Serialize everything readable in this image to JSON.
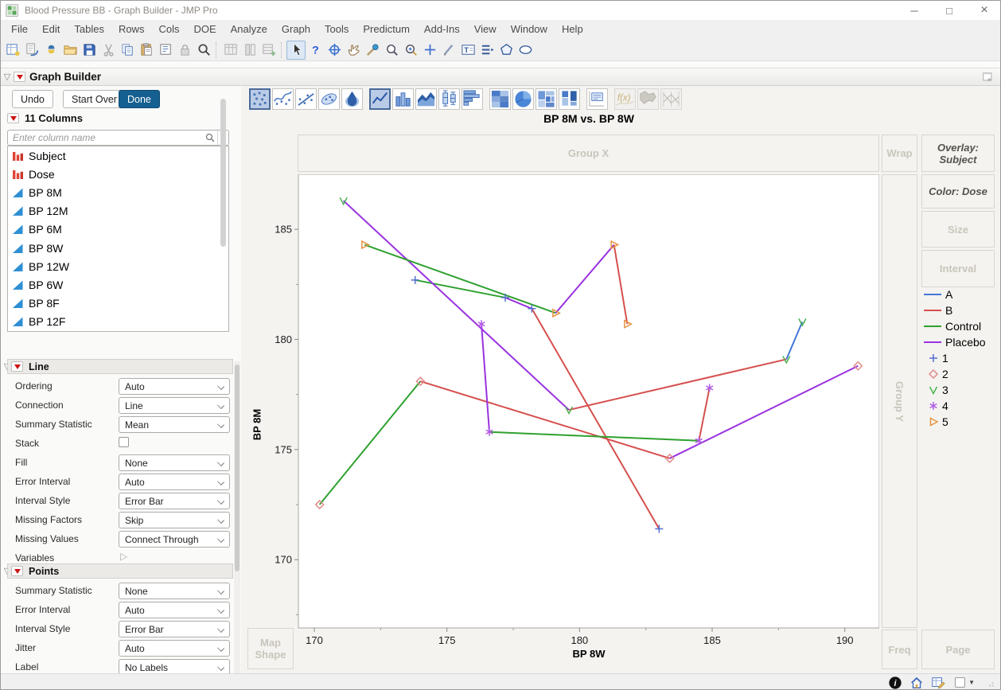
{
  "window": {
    "title": "Blood Pressure BB - Graph Builder - JMP Pro",
    "controls": [
      {
        "name": "minimize"
      },
      {
        "name": "maximize"
      },
      {
        "name": "close"
      }
    ]
  },
  "menu": {
    "items": [
      "File",
      "Edit",
      "Tables",
      "Rows",
      "Cols",
      "DOE",
      "Analyze",
      "Graph",
      "Tools",
      "Predictum",
      "Add-Ins",
      "View",
      "Window",
      "Help"
    ]
  },
  "toolbar": {
    "groups": [
      {
        "items": [
          {
            "name": "new-journal"
          },
          {
            "name": "new-data-view"
          },
          {
            "name": "python"
          },
          {
            "name": "open"
          },
          {
            "name": "save"
          },
          {
            "name": "cut",
            "disabled": true
          },
          {
            "name": "copy"
          },
          {
            "name": "paste"
          },
          {
            "name": "layout"
          },
          {
            "name": "lock",
            "disabled": true
          },
          {
            "name": "search"
          }
        ]
      },
      {
        "items": [
          {
            "name": "data-table",
            "disabled": true
          },
          {
            "name": "column-info",
            "disabled": true
          },
          {
            "name": "add-rows",
            "disabled": true
          }
        ]
      },
      {
        "items": [
          {
            "name": "cursor",
            "selected": true
          },
          {
            "name": "help"
          },
          {
            "name": "crosshair"
          },
          {
            "name": "hand"
          },
          {
            "name": "brush"
          },
          {
            "name": "magnifier"
          },
          {
            "name": "zoom-in"
          },
          {
            "name": "plus-tool"
          },
          {
            "name": "pencil"
          },
          {
            "name": "annotate"
          },
          {
            "name": "arrange"
          },
          {
            "name": "polygon"
          },
          {
            "name": "oval"
          }
        ]
      }
    ]
  },
  "graph_builder": {
    "title": "Graph Builder",
    "undo_label": "Undo",
    "start_over_label": "Start Over",
    "done_label": "Done"
  },
  "palette": {
    "items": [
      {
        "name": "points",
        "selected": true
      },
      {
        "name": "smoother"
      },
      {
        "name": "line-of-fit"
      },
      {
        "name": "ellipse"
      },
      {
        "name": "contour",
        "group_end": true
      },
      {
        "name": "line",
        "selected": true
      },
      {
        "name": "bar"
      },
      {
        "name": "area"
      },
      {
        "name": "box-plot"
      },
      {
        "name": "histogram",
        "group_end": true
      },
      {
        "name": "heatmap"
      },
      {
        "name": "pie"
      },
      {
        "name": "treemap"
      },
      {
        "name": "mosaic",
        "group_end": true
      },
      {
        "name": "caption-box",
        "group_end": true
      },
      {
        "name": "formula",
        "disabled": true
      },
      {
        "name": "map-shapes",
        "disabled": true
      },
      {
        "name": "parallel-plot",
        "disabled": true
      }
    ]
  },
  "columns_panel": {
    "header": "11 Columns",
    "search_placeholder": "Enter column name",
    "items": [
      {
        "label": "Subject",
        "type": "nominal"
      },
      {
        "label": "Dose",
        "type": "nominal"
      },
      {
        "label": "BP 8M",
        "type": "continuous"
      },
      {
        "label": "BP 12M",
        "type": "continuous"
      },
      {
        "label": "BP 6M",
        "type": "continuous"
      },
      {
        "label": "BP 8W",
        "type": "continuous"
      },
      {
        "label": "BP 12W",
        "type": "continuous"
      },
      {
        "label": "BP 6W",
        "type": "continuous"
      },
      {
        "label": "BP 8F",
        "type": "continuous"
      },
      {
        "label": "BP 12F",
        "type": "continuous"
      }
    ]
  },
  "line_panel": {
    "title": "Line",
    "rows": [
      {
        "label": "Ordering",
        "control": "select",
        "value": "Auto"
      },
      {
        "label": "Connection",
        "control": "select",
        "value": "Line"
      },
      {
        "label": "Summary Statistic",
        "control": "select",
        "value": "Mean"
      },
      {
        "label": "Stack",
        "control": "checkbox",
        "value": false
      },
      {
        "label": "Fill",
        "control": "select",
        "value": "None"
      },
      {
        "label": "Error Interval",
        "control": "select",
        "value": "Auto"
      },
      {
        "label": "Interval Style",
        "control": "select",
        "value": "Error Bar"
      },
      {
        "label": "Missing Factors",
        "control": "select",
        "value": "Skip"
      },
      {
        "label": "Missing Values",
        "control": "select",
        "value": "Connect Through"
      },
      {
        "label": "Variables",
        "control": "disclosure",
        "value": ""
      }
    ]
  },
  "points_panel": {
    "title": "Points",
    "rows": [
      {
        "label": "Summary Statistic",
        "control": "select",
        "value": "None"
      },
      {
        "label": "Error Interval",
        "control": "select",
        "value": "Auto"
      },
      {
        "label": "Interval Style",
        "control": "select",
        "value": "Error Bar"
      },
      {
        "label": "Jitter",
        "control": "select",
        "value": "Auto"
      },
      {
        "label": "Label",
        "control": "select",
        "value": "No Labels"
      }
    ]
  },
  "drop_zones": {
    "group_x": "Group X",
    "wrap": "Wrap",
    "overlay_line1": "Overlay:",
    "overlay_line2": "Subject",
    "color": "Color: Dose",
    "size": "Size",
    "interval": "Interval",
    "group_y": "Group Y",
    "map_line1": "Map",
    "map_line2": "Shape",
    "freq": "Freq",
    "page": "Page"
  },
  "chart_data": {
    "type": "scatter",
    "title": "BP 8M vs. BP 8W",
    "xlabel": "BP 8W",
    "ylabel": "BP 8M",
    "xlim": [
      169.4,
      191.3
    ],
    "ylim": [
      166.9,
      187.5
    ],
    "xticks": [
      170,
      175,
      180,
      185,
      190
    ],
    "yticks": [
      170,
      175,
      180,
      185
    ],
    "xticks_minor": [
      172.5,
      177.5,
      182.5,
      187.5
    ],
    "yticks_minor": [
      167.5,
      172.5,
      177.5,
      182.5
    ],
    "grid": false,
    "legend_position": "right",
    "line_rule": "consecutive points per subject; segment colored by dose of left endpoint",
    "dose_colors": {
      "A": "#4577d6",
      "B": "#d5504e",
      "Control": "#2fa12f",
      "Placebo": "#9a33e0"
    },
    "subjects": [
      {
        "subject": "1",
        "marker": "plus",
        "marker_color": "#5570d0",
        "points": [
          {
            "x": 173.8,
            "y": 182.7,
            "dose": "Control"
          },
          {
            "x": 177.2,
            "y": 181.9,
            "dose": "Placebo"
          },
          {
            "x": 178.2,
            "y": 181.4,
            "dose": "B"
          },
          {
            "x": 183.0,
            "y": 171.4,
            "dose": "A"
          }
        ]
      },
      {
        "subject": "2",
        "marker": "diamond",
        "marker_color": "#e08a8a",
        "points": [
          {
            "x": 170.2,
            "y": 172.5,
            "dose": "Control"
          },
          {
            "x": 174.0,
            "y": 178.1,
            "dose": "B"
          },
          {
            "x": 183.4,
            "y": 174.6,
            "dose": "Placebo"
          },
          {
            "x": 190.5,
            "y": 178.8,
            "dose": "A"
          }
        ]
      },
      {
        "subject": "3",
        "marker": "v",
        "marker_color": "#49b14f",
        "points": [
          {
            "x": 171.1,
            "y": 186.3,
            "dose": "Placebo"
          },
          {
            "x": 179.6,
            "y": 176.8,
            "dose": "B"
          },
          {
            "x": 187.8,
            "y": 179.1,
            "dose": "A"
          },
          {
            "x": 188.4,
            "y": 180.8,
            "dose": "Control"
          }
        ]
      },
      {
        "subject": "4",
        "marker": "asterisk",
        "marker_color": "#b25ce4",
        "points": [
          {
            "x": 176.3,
            "y": 180.7,
            "dose": "Placebo"
          },
          {
            "x": 176.6,
            "y": 175.8,
            "dose": "Control"
          },
          {
            "x": 184.5,
            "y": 175.4,
            "dose": "B"
          },
          {
            "x": 184.9,
            "y": 177.8,
            "dose": "A"
          }
        ]
      },
      {
        "subject": "5",
        "marker": "triangle-right",
        "marker_color": "#e69340",
        "points": [
          {
            "x": 171.9,
            "y": 184.3,
            "dose": "Control"
          },
          {
            "x": 179.1,
            "y": 181.2,
            "dose": "Placebo"
          },
          {
            "x": 181.3,
            "y": 184.3,
            "dose": "B"
          },
          {
            "x": 181.8,
            "y": 180.7,
            "dose": "A"
          }
        ]
      }
    ],
    "legend": {
      "lines": [
        {
          "label": "A",
          "color": "#4577d6"
        },
        {
          "label": "B",
          "color": "#d5504e"
        },
        {
          "label": "Control",
          "color": "#2fa12f"
        },
        {
          "label": "Placebo",
          "color": "#9a33e0"
        }
      ],
      "markers": [
        {
          "label": "1",
          "marker": "plus",
          "color": "#5570d0"
        },
        {
          "label": "2",
          "marker": "diamond",
          "color": "#e08a8a"
        },
        {
          "label": "3",
          "marker": "v",
          "color": "#49b14f"
        },
        {
          "label": "4",
          "marker": "asterisk",
          "color": "#b25ce4"
        },
        {
          "label": "5",
          "marker": "triangle-right",
          "color": "#e69340"
        }
      ]
    }
  },
  "status_bar": {
    "icons": [
      {
        "name": "info"
      },
      {
        "name": "home"
      },
      {
        "name": "table-edit"
      }
    ]
  }
}
